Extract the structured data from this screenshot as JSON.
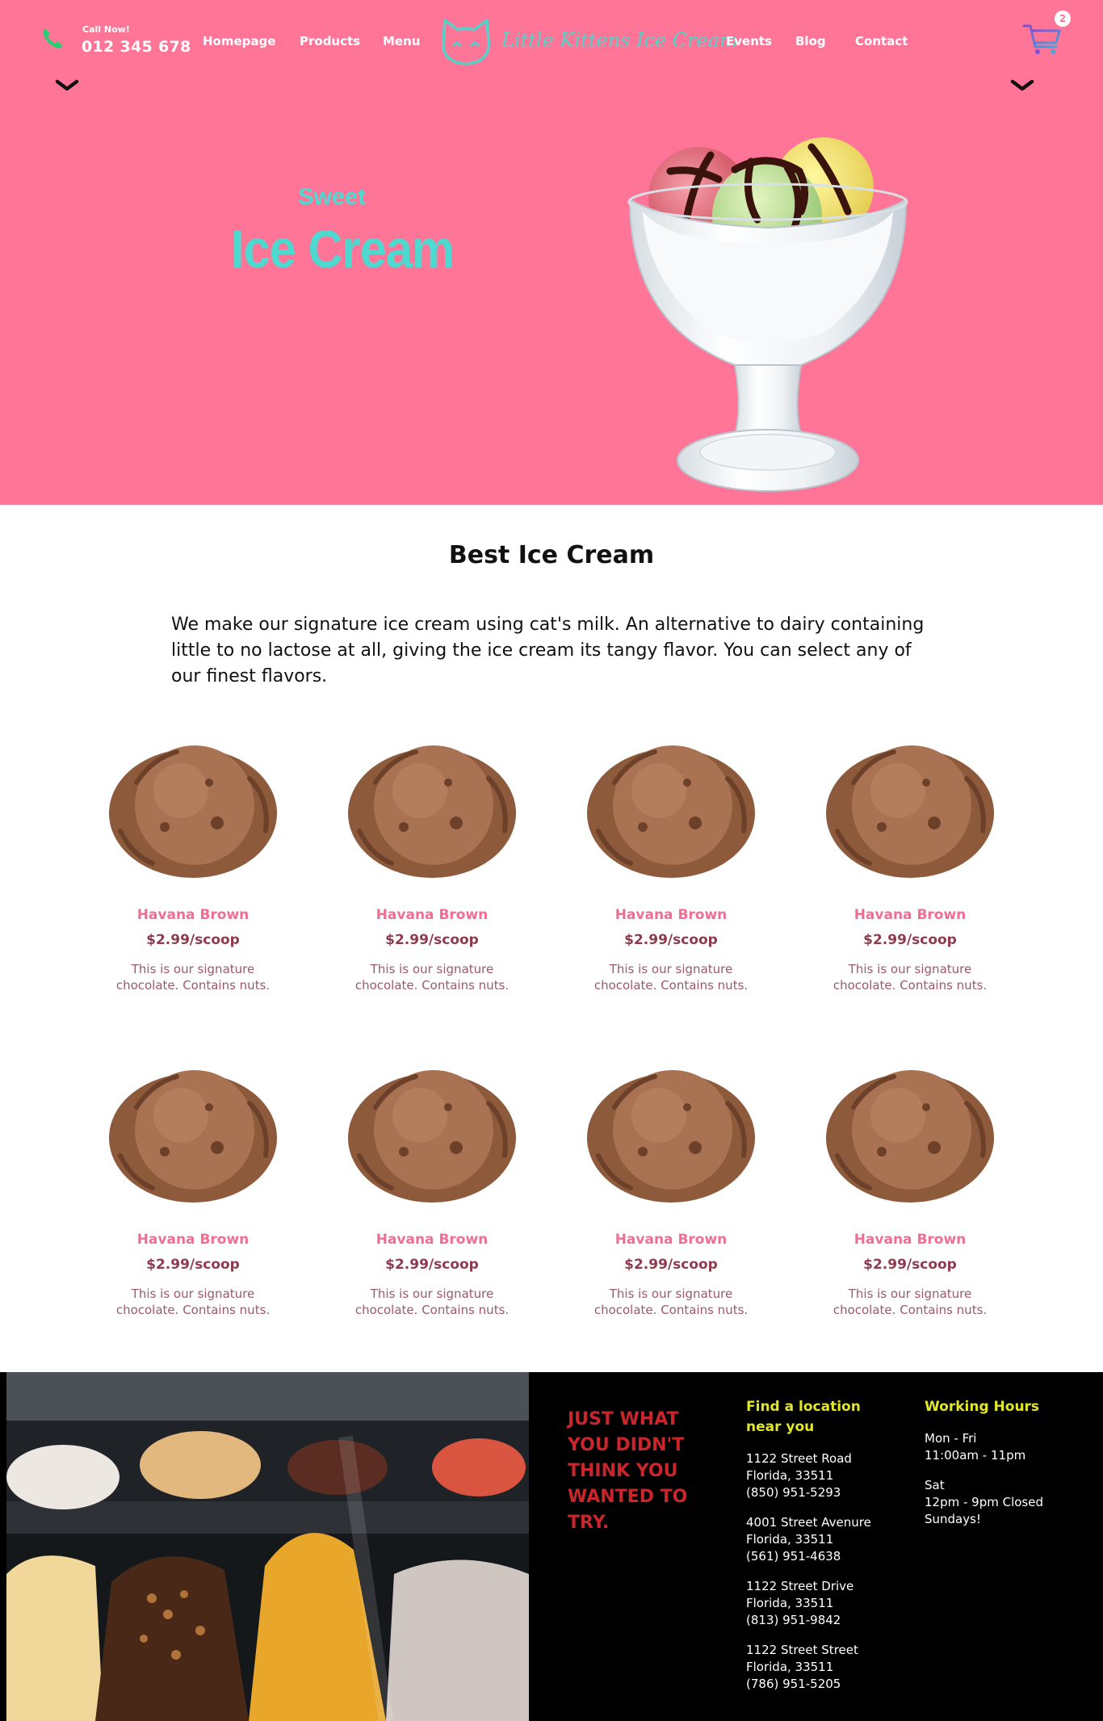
{
  "nav": {
    "call_label": "Call Now!",
    "call_number": "012 345 678",
    "links": [
      "Homepage",
      "Products",
      "Menu",
      "Events",
      "Blog",
      "Contact"
    ],
    "logo_text": "Little Kittens Ice Cream",
    "cart_count": "2",
    "icons": [
      "phone-icon",
      "cat-logo-icon",
      "cart-icon",
      "chevron-down-icon"
    ]
  },
  "hero": {
    "kicker": "Sweet",
    "title": "Ice Cream",
    "image": "ice-cream-sundae-glass"
  },
  "best": {
    "title": "Best Ice Cream",
    "intro": "We make our signature ice cream using cat's milk. An alternative to dairy containing little to no lactose at all, giving the ice cream its tangy flavor. You can select any of our finest flavors."
  },
  "products": [
    {
      "name": "Havana Brown",
      "price": "$2.99/scoop",
      "desc": "This is our signature chocolate. Contains nuts."
    },
    {
      "name": "Havana Brown",
      "price": "$2.99/scoop",
      "desc": "This is our signature chocolate. Contains nuts."
    },
    {
      "name": "Havana Brown",
      "price": "$2.99/scoop",
      "desc": "This is our signature chocolate. Contains nuts."
    },
    {
      "name": "Havana Brown",
      "price": "$2.99/scoop",
      "desc": "This is our signature chocolate. Contains nuts."
    },
    {
      "name": "Havana Brown",
      "price": "$2.99/scoop",
      "desc": "This is our signature chocolate. Contains nuts."
    },
    {
      "name": "Havana Brown",
      "price": "$2.99/scoop",
      "desc": "This is our signature chocolate. Contains nuts."
    },
    {
      "name": "Havana Brown",
      "price": "$2.99/scoop",
      "desc": "This is our signature chocolate. Contains nuts."
    },
    {
      "name": "Havana Brown",
      "price": "$2.99/scoop",
      "desc": "This is our signature chocolate. Contains nuts."
    }
  ],
  "footer": {
    "tagline": "JUST WHAT YOU DIDN'T THINK YOU WANTED TO TRY.",
    "locations_heading": "Find a location near you",
    "locations": [
      {
        "street": "1122 Street Road",
        "city": "Florida, 33511",
        "phone": "(850) 951-5293"
      },
      {
        "street": "4001 Street Avenure",
        "city": "Florida, 33511",
        "phone": "(561) 951-4638"
      },
      {
        "street": "1122 Street Drive",
        "city": "Florida, 33511",
        "phone": "(813) 951-9842"
      },
      {
        "street": "1122 Street Street",
        "city": "Florida, 33511",
        "phone": "(786) 951-5205"
      }
    ],
    "hours_heading": "Working Hours",
    "hours": [
      {
        "days": "Mon - Fri",
        "time": "11:00am - 11pm"
      },
      {
        "days": "Sat",
        "time": "12pm - 9pm Closed Sundays!"
      }
    ]
  },
  "colors": {
    "hero_bg": "#ff7597",
    "accent_teal": "#4dd9cf",
    "product_name": "#ef6f92",
    "product_price": "#8f3b4f",
    "footer_bg": "#000000",
    "footer_heading": "#e2e629",
    "footer_tagline": "#c9252c"
  }
}
